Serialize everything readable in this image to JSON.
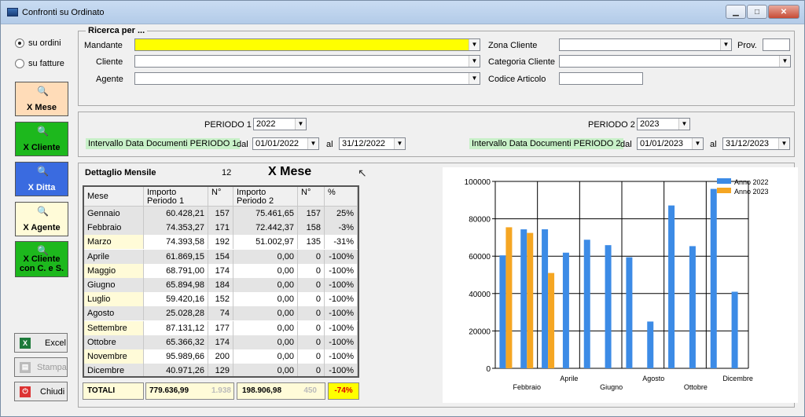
{
  "window": {
    "title": "Confronti su Ordinato",
    "btn_min": "▁",
    "btn_max": "□",
    "btn_close": "✕"
  },
  "left": {
    "radio_ordini": "su ordini",
    "radio_fatture": "su fatture",
    "btn_mese": "X Mese",
    "btn_cliente": "X Cliente",
    "btn_ditta": "X Ditta",
    "btn_agente": "X Agente",
    "btn_cliente_cs": "X Cliente con C. e S.",
    "btn_excel": "Excel",
    "btn_stampa": "Stampa",
    "btn_chiudi": "Chiudi",
    "colors": {
      "mese": "#ffdcb8",
      "cliente": "#1db81d",
      "ditta": "#3a6be0",
      "agente": "#fffbd8",
      "cliente_cs": "#1db81d"
    }
  },
  "search": {
    "legend": "Ricerca per ...",
    "mandante": "Mandante",
    "cliente": "Cliente",
    "agente": "Agente",
    "zona_cliente": "Zona Cliente",
    "prov": "Prov.",
    "categoria_cliente": "Categoria Cliente",
    "codice_articolo": "Codice Articolo",
    "mandante_color": "#ffff00"
  },
  "periodi": {
    "p1_label": "PERIODO 1",
    "p1_year": "2022",
    "p2_label": "PERIODO 2",
    "p2_year": "2023",
    "int1": "Intervallo Data Documenti PERIODO 1",
    "int2": "Intervallo Data Documenti PERIODO 2",
    "dal": "dal",
    "al": "al",
    "p1_dal": "01/01/2022",
    "p1_al": "31/12/2022",
    "p2_dal": "01/01/2023",
    "p2_al": "31/12/2023"
  },
  "detail": {
    "title": "Dettaglio Mensile",
    "count": "12",
    "heading": "X Mese",
    "columns": [
      "Mese",
      "Importo Periodo 1",
      "N°",
      "Importo Periodo 2",
      "N°",
      "%"
    ],
    "rows": [
      [
        "Gennaio",
        "60.428,21",
        "157",
        "75.461,65",
        "157",
        "25%"
      ],
      [
        "Febbraio",
        "74.353,27",
        "171",
        "72.442,37",
        "158",
        "-3%"
      ],
      [
        "Marzo",
        "74.393,58",
        "192",
        "51.002,97",
        "135",
        "-31%"
      ],
      [
        "Aprile",
        "61.869,15",
        "154",
        "0,00",
        "0",
        "-100%"
      ],
      [
        "Maggio",
        "68.791,00",
        "174",
        "0,00",
        "0",
        "-100%"
      ],
      [
        "Giugno",
        "65.894,98",
        "184",
        "0,00",
        "0",
        "-100%"
      ],
      [
        "Luglio",
        "59.420,16",
        "152",
        "0,00",
        "0",
        "-100%"
      ],
      [
        "Agosto",
        "25.028,28",
        "74",
        "0,00",
        "0",
        "-100%"
      ],
      [
        "Settembre",
        "87.131,12",
        "177",
        "0,00",
        "0",
        "-100%"
      ],
      [
        "Ottobre",
        "65.366,32",
        "174",
        "0,00",
        "0",
        "-100%"
      ],
      [
        "Novembre",
        "95.989,66",
        "200",
        "0,00",
        "0",
        "-100%"
      ],
      [
        "Dicembre",
        "40.971,26",
        "129",
        "0,00",
        "0",
        "-100%"
      ]
    ],
    "totals": {
      "label": "TOTALI",
      "imp1": "779.636,99",
      "n1": "1.938",
      "imp2": "198.906,98",
      "n2": "450",
      "pct": "-74%"
    }
  },
  "chart_data": {
    "type": "bar",
    "categories": [
      "Gennaio",
      "Febbraio",
      "Marzo",
      "Aprile",
      "Maggio",
      "Giugno",
      "Luglio",
      "Agosto",
      "Settembre",
      "Ottobre",
      "Novembre",
      "Dicembre"
    ],
    "x_tick_labels": [
      "",
      "Febbraio",
      "",
      "Aprile",
      "",
      "Giugno",
      "",
      "Agosto",
      "",
      "Ottobre",
      "",
      "Dicembre"
    ],
    "series": [
      {
        "name": "Anno 2022",
        "color": "#3c8be6",
        "values": [
          60428.21,
          74353.27,
          74393.58,
          61869.15,
          68791.0,
          65894.98,
          59420.16,
          25028.28,
          87131.12,
          65366.32,
          95989.66,
          40971.26
        ]
      },
      {
        "name": "Anno 2023",
        "color": "#f5a623",
        "values": [
          75461.65,
          72442.37,
          51002.97,
          0,
          0,
          0,
          0,
          0,
          0,
          0,
          0,
          0
        ]
      }
    ],
    "ylim": [
      0,
      100000
    ],
    "yticks": [
      "0",
      "20000",
      "40000",
      "60000",
      "80000",
      "100000"
    ],
    "grid": true,
    "legend": "top-right"
  }
}
